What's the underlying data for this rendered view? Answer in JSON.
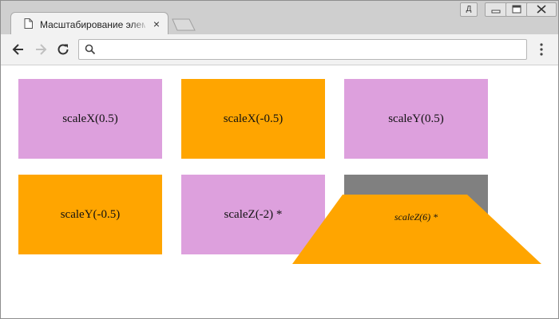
{
  "browser": {
    "tab_title": "Масштабирование элемен",
    "user_button_label": "Д",
    "tab_close_glyph": "×",
    "address_value": "",
    "address_placeholder": ""
  },
  "content": {
    "boxes": [
      {
        "label": "scaleX(0.5)",
        "color": "#dda0dd"
      },
      {
        "label": "scaleX(-0.5)",
        "color": "#ffa500"
      },
      {
        "label": "scaleY(0.5)",
        "color": "#dda0dd"
      },
      {
        "label": "scaleY(-0.5)",
        "color": "#ffa500"
      },
      {
        "label": "scaleZ(-2) *",
        "color": "#dda0dd"
      },
      {
        "label": "scaleZ(6) *",
        "color": "#808080"
      }
    ],
    "overlay_color": "#ffa500"
  }
}
